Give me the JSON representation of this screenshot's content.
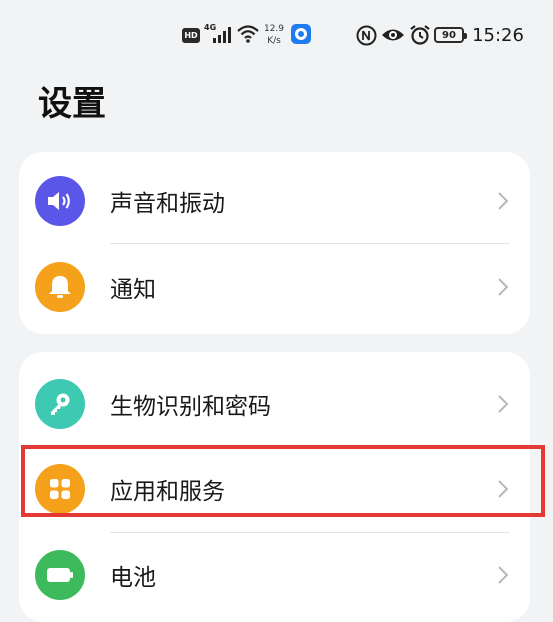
{
  "status_bar": {
    "hd": "HD",
    "network_type": "4G",
    "speed_value": "12.9",
    "speed_unit": "K/s",
    "battery_level": "90",
    "time": "15:26",
    "icons": [
      "signal-icon",
      "wifi-icon",
      "app-notification-icon",
      "nfc-icon",
      "eye-icon",
      "alarm-icon",
      "battery-icon"
    ]
  },
  "page": {
    "title": "设置"
  },
  "groups": [
    {
      "items": [
        {
          "label": "声音和振动",
          "icon": "volume-icon",
          "color": "#5a57e8"
        },
        {
          "label": "通知",
          "icon": "bell-icon",
          "color": "#f5a11b"
        }
      ]
    },
    {
      "items": [
        {
          "label": "生物识别和密码",
          "icon": "key-icon",
          "color": "#3ec9b3"
        },
        {
          "label": "应用和服务",
          "icon": "apps-grid-icon",
          "color": "#f5a11b",
          "highlighted": true
        },
        {
          "label": "电池",
          "icon": "battery-icon",
          "color": "#3dbb5c"
        }
      ]
    }
  ],
  "colors": {
    "background": "#f1f3f5",
    "card": "#ffffff",
    "highlight": "#e53935",
    "chevron": "#b8b8b8"
  }
}
